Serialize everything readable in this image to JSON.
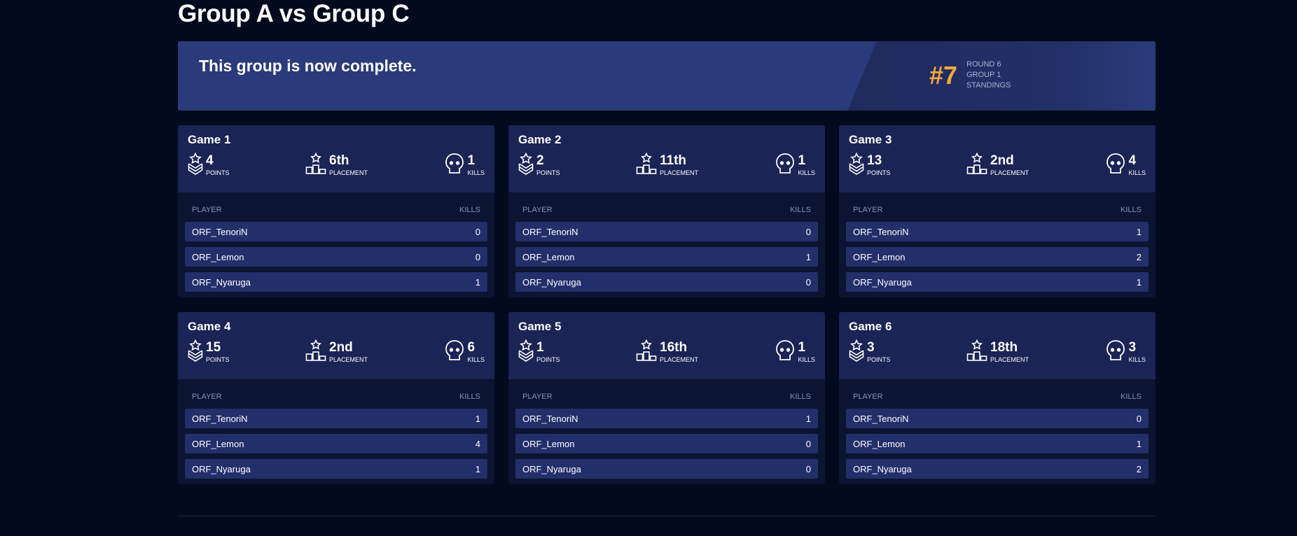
{
  "page": {
    "title": "Group A vs Group C"
  },
  "banner": {
    "message": "This group is now complete.",
    "rank": "#7",
    "round": "ROUND 6",
    "group": "GROUP 1",
    "standings": "STANDINGS"
  },
  "labels": {
    "points": "POINTS",
    "placement": "PLACEMENT",
    "kills": "KILLS",
    "player_col": "PLAYER",
    "kills_col": "KILLS"
  },
  "colors": {
    "background": "#020a1d",
    "banner": "#2b3a7a",
    "card_head": "#1a2455",
    "row": "#232f6b",
    "rank_accent": "#f5a83a"
  },
  "icons": {
    "points": "chevron-badge-star-icon",
    "placement": "podium-star-icon",
    "kills": "skull-icon"
  },
  "games": [
    {
      "title": "Game 1",
      "points": "4",
      "placement": "6th",
      "kills": "1",
      "players": [
        {
          "name": "ORF_TenoriN",
          "kills": "0"
        },
        {
          "name": "ORF_Lemon",
          "kills": "0"
        },
        {
          "name": "ORF_Nyaruga",
          "kills": "1"
        }
      ]
    },
    {
      "title": "Game 2",
      "points": "2",
      "placement": "11th",
      "kills": "1",
      "players": [
        {
          "name": "ORF_TenoriN",
          "kills": "0"
        },
        {
          "name": "ORF_Lemon",
          "kills": "1"
        },
        {
          "name": "ORF_Nyaruga",
          "kills": "0"
        }
      ]
    },
    {
      "title": "Game 3",
      "points": "13",
      "placement": "2nd",
      "kills": "4",
      "players": [
        {
          "name": "ORF_TenoriN",
          "kills": "1"
        },
        {
          "name": "ORF_Lemon",
          "kills": "2"
        },
        {
          "name": "ORF_Nyaruga",
          "kills": "1"
        }
      ]
    },
    {
      "title": "Game 4",
      "points": "15",
      "placement": "2nd",
      "kills": "6",
      "players": [
        {
          "name": "ORF_TenoriN",
          "kills": "1"
        },
        {
          "name": "ORF_Lemon",
          "kills": "4"
        },
        {
          "name": "ORF_Nyaruga",
          "kills": "1"
        }
      ]
    },
    {
      "title": "Game 5",
      "points": "1",
      "placement": "16th",
      "kills": "1",
      "players": [
        {
          "name": "ORF_TenoriN",
          "kills": "1"
        },
        {
          "name": "ORF_Lemon",
          "kills": "0"
        },
        {
          "name": "ORF_Nyaruga",
          "kills": "0"
        }
      ]
    },
    {
      "title": "Game 6",
      "points": "3",
      "placement": "18th",
      "kills": "3",
      "players": [
        {
          "name": "ORF_TenoriN",
          "kills": "0"
        },
        {
          "name": "ORF_Lemon",
          "kills": "1"
        },
        {
          "name": "ORF_Nyaruga",
          "kills": "2"
        }
      ]
    }
  ]
}
